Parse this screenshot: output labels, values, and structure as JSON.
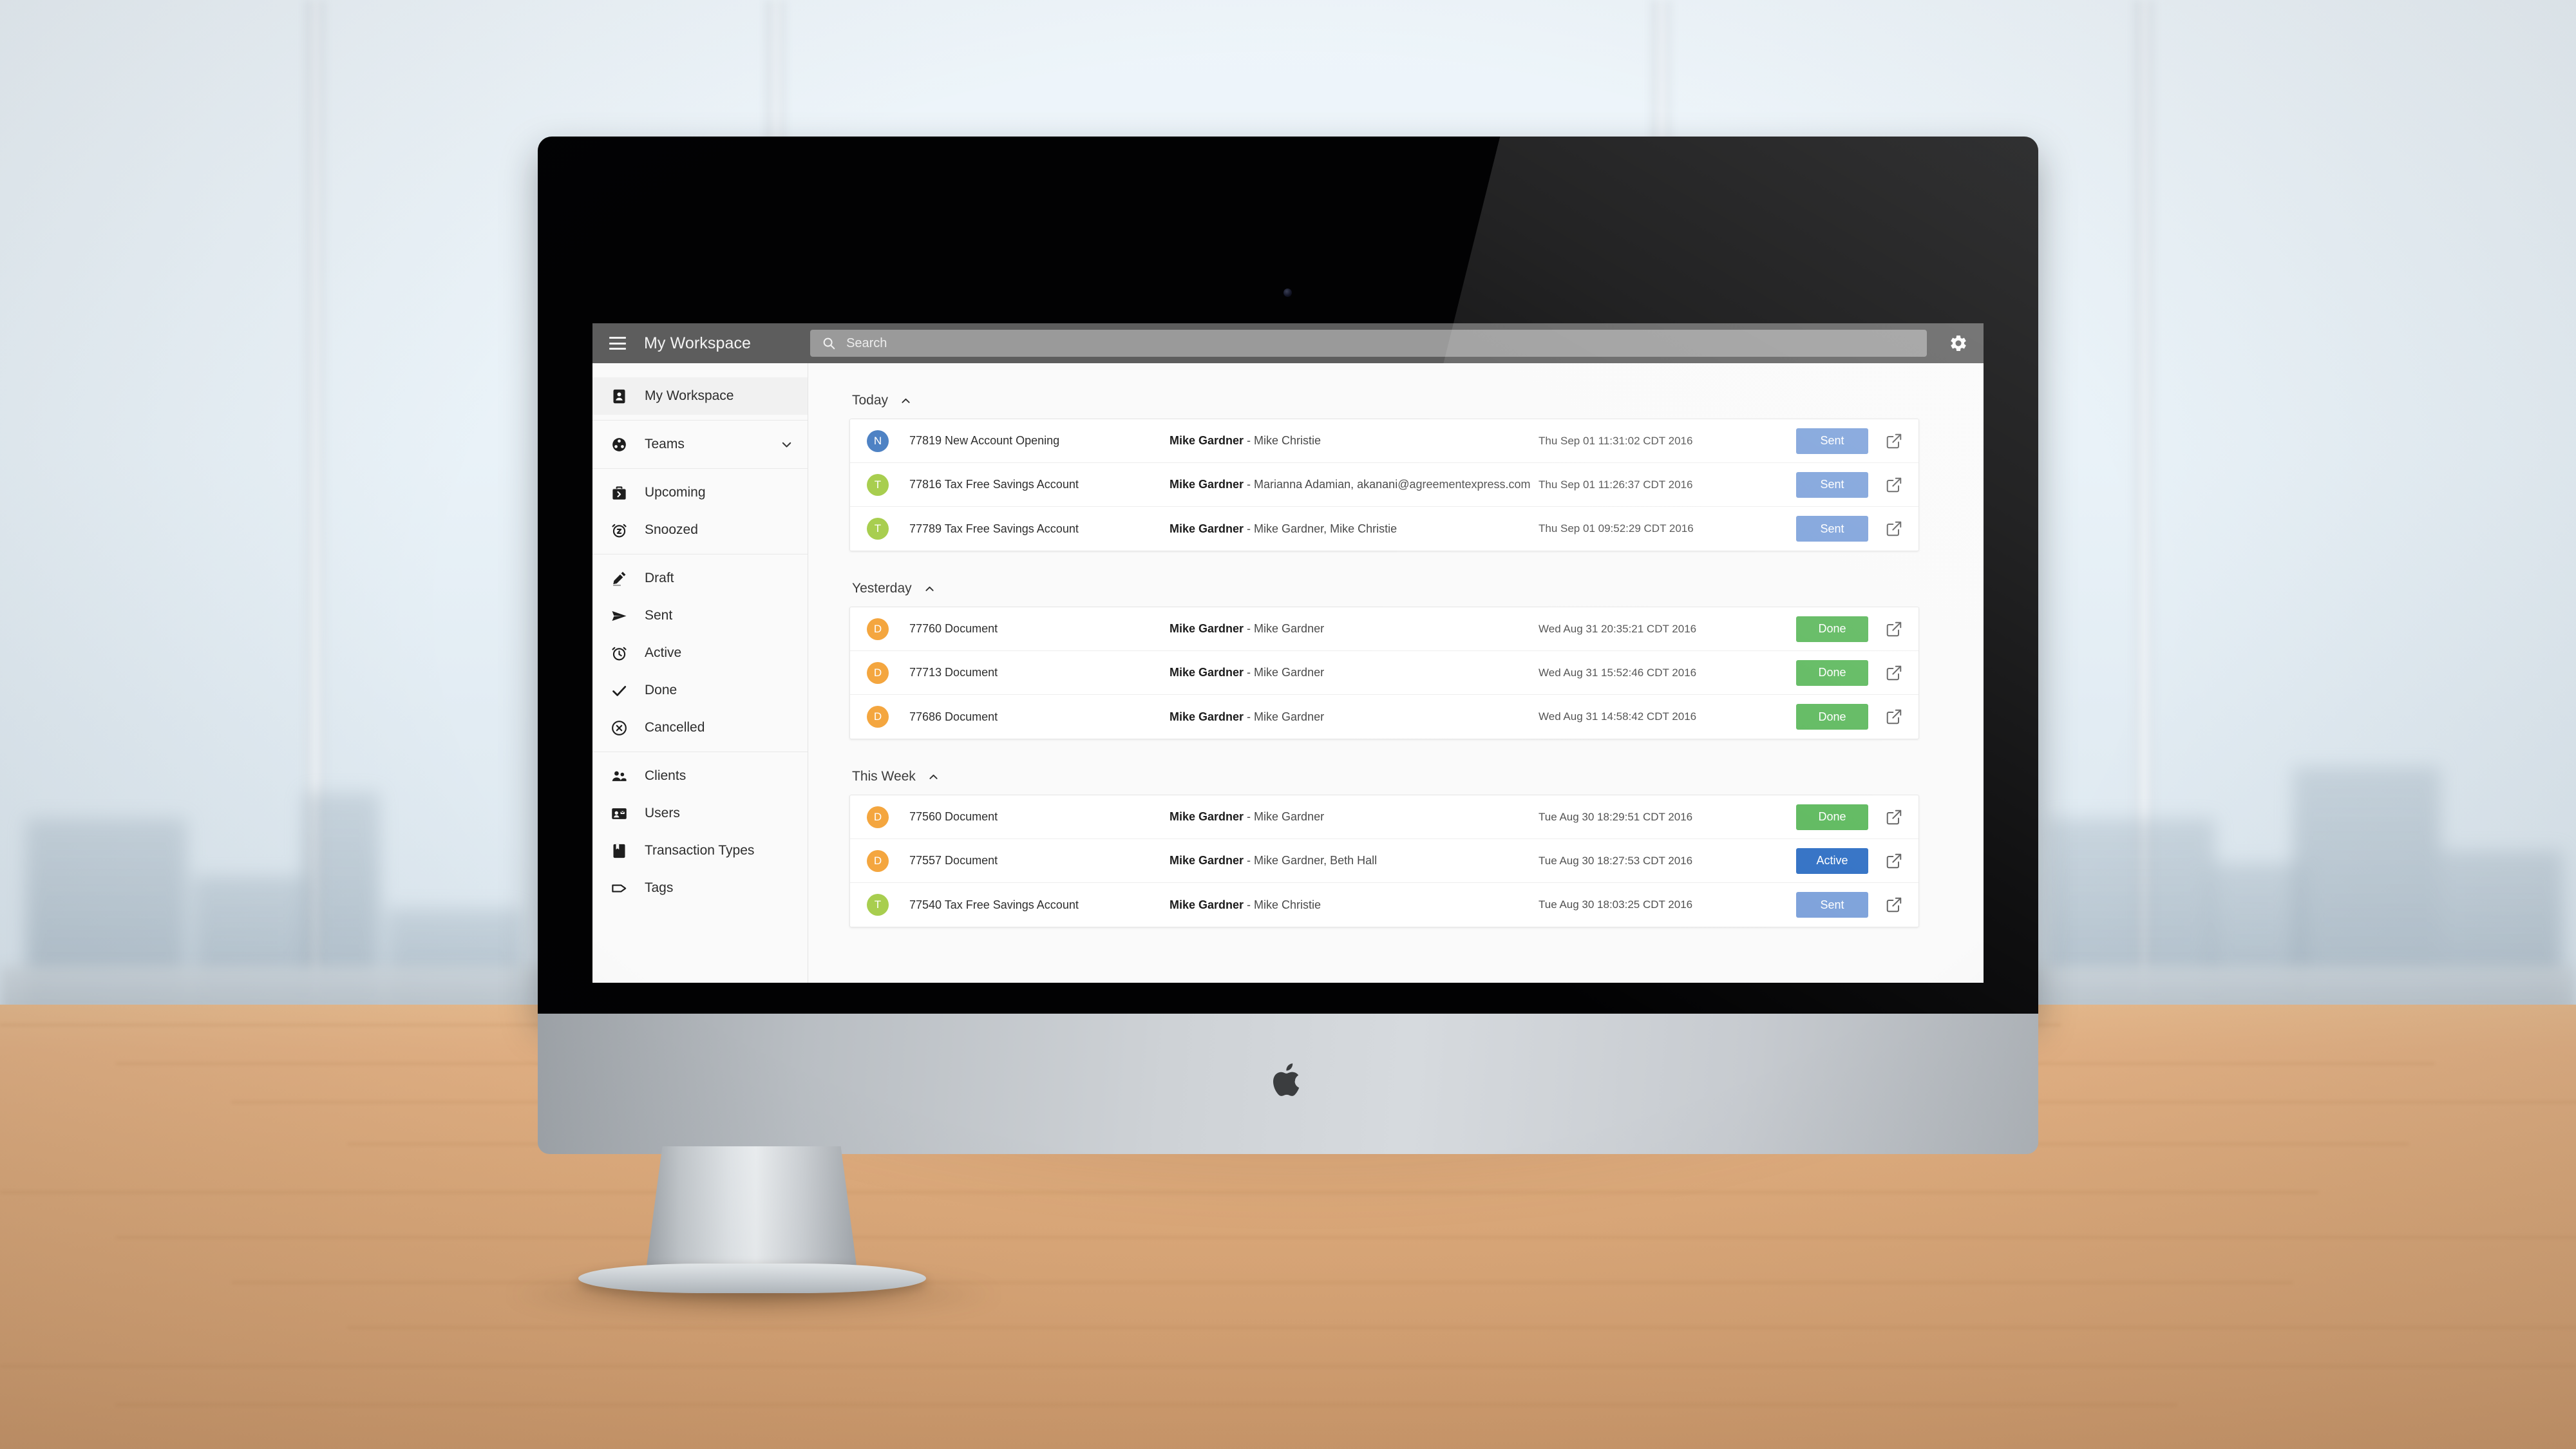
{
  "app": {
    "title": "My Workspace",
    "menu_icon": "hamburger-icon",
    "settings_icon": "gear-icon"
  },
  "search": {
    "placeholder": "Search",
    "value": "",
    "icon": "search-icon"
  },
  "sidebar": {
    "groups": [
      {
        "items": [
          {
            "label": "My Workspace",
            "icon": "contact-card-icon",
            "active": true
          }
        ]
      },
      {
        "items": [
          {
            "label": "Teams",
            "icon": "teams-icon",
            "expandable": true,
            "caret": "chevron-down-icon"
          }
        ]
      },
      {
        "items": [
          {
            "label": "Upcoming",
            "icon": "briefcase-icon"
          },
          {
            "label": "Snoozed",
            "icon": "alarm-snooze-icon"
          }
        ]
      },
      {
        "items": [
          {
            "label": "Draft",
            "icon": "pencil-icon"
          },
          {
            "label": "Sent",
            "icon": "paper-plane-icon"
          },
          {
            "label": "Active",
            "icon": "alarm-clock-icon"
          },
          {
            "label": "Done",
            "icon": "check-icon"
          },
          {
            "label": "Cancelled",
            "icon": "cancel-circle-icon"
          }
        ]
      },
      {
        "items": [
          {
            "label": "Clients",
            "icon": "people-icon"
          },
          {
            "label": "Users",
            "icon": "id-badge-icon"
          },
          {
            "label": "Transaction Types",
            "icon": "book-icon"
          },
          {
            "label": "Tags",
            "icon": "tag-icon"
          }
        ]
      }
    ]
  },
  "colors": {
    "avatar_new_account": "#4e82c4",
    "avatar_tax_free": "#a8ce4f",
    "avatar_document": "#f4a63f",
    "badge_sent": "#7ba0da",
    "badge_done": "#5cb85c",
    "badge_active": "#2f6fc4",
    "topbar": "#5d5d5d",
    "search_field": "#9a9a9a"
  },
  "sections": [
    {
      "title": "Today",
      "caret": "chevron-up-icon",
      "rows": [
        {
          "avatar_letter": "N",
          "avatar_color": "#4e82c4",
          "title": "77819 New Account Opening",
          "sender": "Mike Gardner",
          "separator": " - ",
          "recipients": "Mike Christie",
          "date": "Thu Sep 01 11:31:02 CDT 2016",
          "status": "Sent",
          "status_color": "#7ba0da",
          "open_icon": "open-external-icon"
        },
        {
          "avatar_letter": "T",
          "avatar_color": "#a8ce4f",
          "title": "77816 Tax Free Savings Account",
          "sender": "Mike Gardner",
          "separator": " - ",
          "recipients": "Marianna Adamian, akanani@agreementexpress.com",
          "date": "Thu Sep 01 11:26:37 CDT 2016",
          "status": "Sent",
          "status_color": "#7ba0da",
          "open_icon": "open-external-icon"
        },
        {
          "avatar_letter": "T",
          "avatar_color": "#a8ce4f",
          "title": "77789 Tax Free Savings Account",
          "sender": "Mike Gardner",
          "separator": " - ",
          "recipients": "Mike Gardner, Mike Christie",
          "date": "Thu Sep 01 09:52:29 CDT 2016",
          "status": "Sent",
          "status_color": "#7ba0da",
          "open_icon": "open-external-icon"
        }
      ]
    },
    {
      "title": "Yesterday",
      "caret": "chevron-up-icon",
      "rows": [
        {
          "avatar_letter": "D",
          "avatar_color": "#f4a63f",
          "title": "77760 Document",
          "sender": "Mike Gardner",
          "separator": " - ",
          "recipients": "Mike Gardner",
          "date": "Wed Aug 31 20:35:21 CDT 2016",
          "status": "Done",
          "status_color": "#5cb85c",
          "open_icon": "open-external-icon"
        },
        {
          "avatar_letter": "D",
          "avatar_color": "#f4a63f",
          "title": "77713 Document",
          "sender": "Mike Gardner",
          "separator": " - ",
          "recipients": "Mike Gardner",
          "date": "Wed Aug 31 15:52:46 CDT 2016",
          "status": "Done",
          "status_color": "#5cb85c",
          "open_icon": "open-external-icon"
        },
        {
          "avatar_letter": "D",
          "avatar_color": "#f4a63f",
          "title": "77686 Document",
          "sender": "Mike Gardner",
          "separator": " - ",
          "recipients": "Mike Gardner",
          "date": "Wed Aug 31 14:58:42 CDT 2016",
          "status": "Done",
          "status_color": "#5cb85c",
          "open_icon": "open-external-icon"
        }
      ]
    },
    {
      "title": "This Week",
      "caret": "chevron-up-icon",
      "rows": [
        {
          "avatar_letter": "D",
          "avatar_color": "#f4a63f",
          "title": "77560 Document",
          "sender": "Mike Gardner",
          "separator": " - ",
          "recipients": "Mike Gardner",
          "date": "Tue Aug 30 18:29:51 CDT 2016",
          "status": "Done",
          "status_color": "#5cb85c",
          "open_icon": "open-external-icon"
        },
        {
          "avatar_letter": "D",
          "avatar_color": "#f4a63f",
          "title": "77557 Document",
          "sender": "Mike Gardner",
          "separator": " - ",
          "recipients": "Mike Gardner, Beth Hall",
          "date": "Tue Aug 30 18:27:53 CDT 2016",
          "status": "Active",
          "status_color": "#2f6fc4",
          "open_icon": "open-external-icon"
        },
        {
          "avatar_letter": "T",
          "avatar_color": "#a8ce4f",
          "title": "77540 Tax Free Savings Account",
          "sender": "Mike Gardner",
          "separator": " - ",
          "recipients": "Mike Christie",
          "date": "Tue Aug 30 18:03:25 CDT 2016",
          "status": "Sent",
          "status_color": "#7ba0da",
          "open_icon": "open-external-icon"
        }
      ]
    }
  ]
}
